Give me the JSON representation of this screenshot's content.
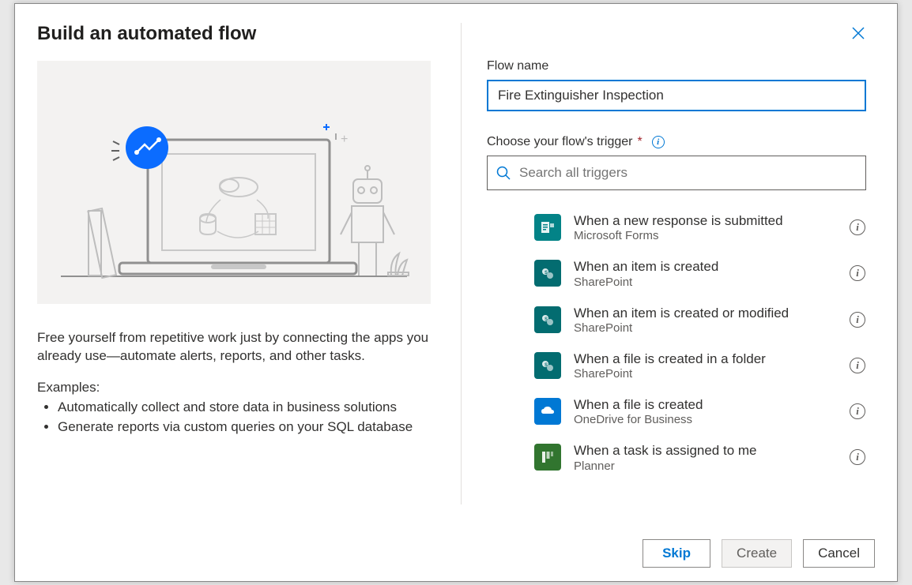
{
  "title": "Build an automated flow",
  "description": "Free yourself from repetitive work just by connecting the apps you already use—automate alerts, reports, and other tasks.",
  "examples_header": "Examples:",
  "examples": [
    "Automatically collect and store data in business solutions",
    "Generate reports via custom queries on your SQL database"
  ],
  "form": {
    "flowname_label": "Flow name",
    "flowname_value": "Fire Extinguisher Inspection",
    "trigger_label": "Choose your flow's trigger",
    "search_placeholder": "Search all triggers"
  },
  "triggers": [
    {
      "title": "When a new response is submitted",
      "source": "Microsoft Forms",
      "icon": "forms"
    },
    {
      "title": "When an item is created",
      "source": "SharePoint",
      "icon": "sp"
    },
    {
      "title": "When an item is created or modified",
      "source": "SharePoint",
      "icon": "sp"
    },
    {
      "title": "When a file is created in a folder",
      "source": "SharePoint",
      "icon": "sp"
    },
    {
      "title": "When a file is created",
      "source": "OneDrive for Business",
      "icon": "od"
    },
    {
      "title": "When a task is assigned to me",
      "source": "Planner",
      "icon": "planner"
    }
  ],
  "footer": {
    "skip": "Skip",
    "create": "Create",
    "cancel": "Cancel"
  },
  "colors": {
    "primary": "#0078d4",
    "forms": "#038387",
    "sharepoint": "#036c70",
    "onedrive": "#0078d4",
    "planner": "#31752f"
  }
}
